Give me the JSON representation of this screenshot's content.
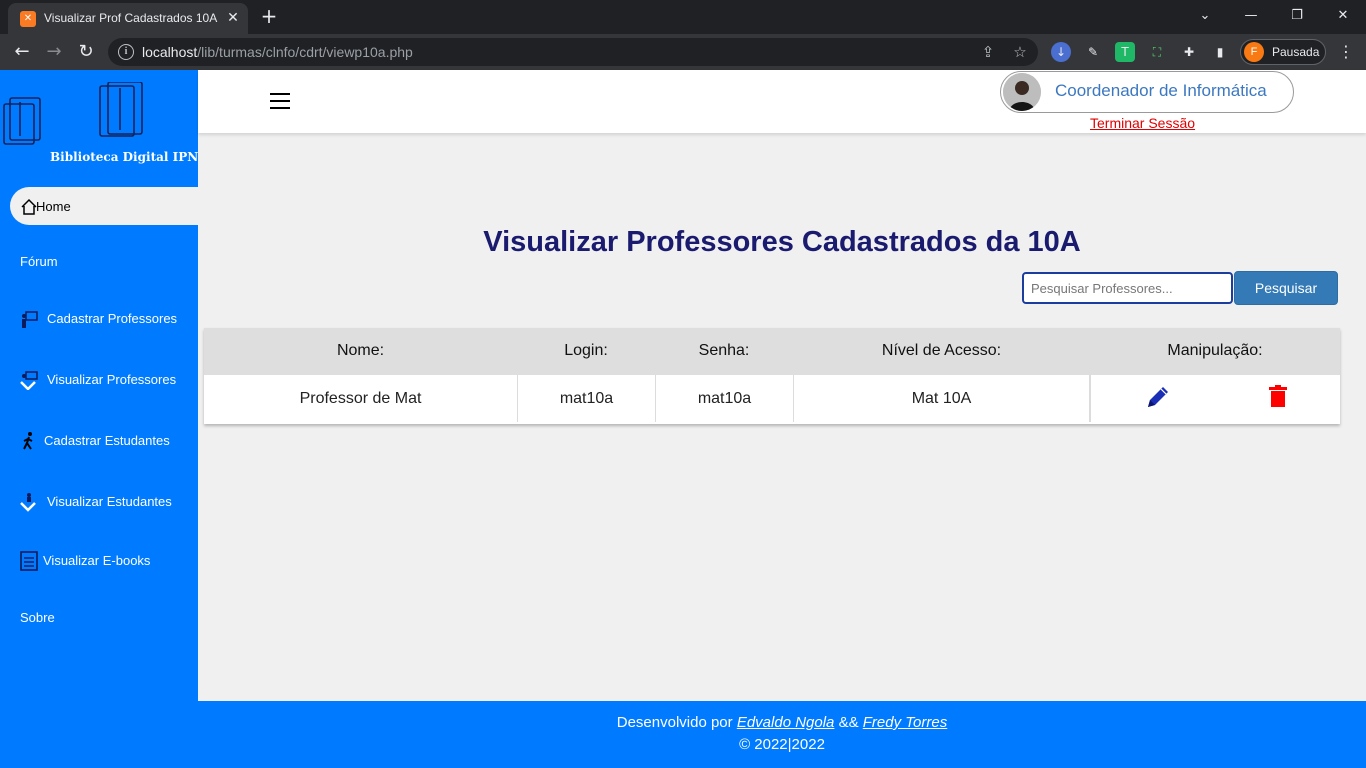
{
  "browser": {
    "tab_title": "Visualizar Prof Cadastrados 10A",
    "url_host": "localhost",
    "url_path": "/lib/turmas/clnfo/cdrt/viewp10a.php",
    "profile_initial": "F",
    "profile_label": "Pausada"
  },
  "sidebar": {
    "logo_text": "Biblioteca Digital IPN",
    "items": [
      {
        "label": "Home",
        "icon": "home-icon"
      },
      {
        "label": "Fórum"
      },
      {
        "label": "Cadastrar Professores",
        "icon": "teacher-board-icon"
      },
      {
        "label": "Visualizar Professores",
        "icon": "teacher-view-icon"
      },
      {
        "label": "Cadastrar Estudantes",
        "icon": "walking-person-icon"
      },
      {
        "label": "Visualizar Estudantes",
        "icon": "student-view-icon"
      },
      {
        "label": "Visualizar E-books",
        "icon": "ebook-icon"
      },
      {
        "label": "Sobre"
      }
    ]
  },
  "header": {
    "user_name": "Coordenador de Informática",
    "logout": "Terminar Sessão"
  },
  "main": {
    "title": "Visualizar Professores Cadastrados da 10A",
    "search_placeholder": "Pesquisar Professores...",
    "search_button": "Pesquisar",
    "columns": [
      "Nome:",
      "Login:",
      "Senha:",
      "Nível de Acesso:",
      "Manipulação:"
    ],
    "rows": [
      {
        "nome": "Professor de Mat",
        "login": "mat10a",
        "senha": "mat10a",
        "nivel": "Mat 10A"
      }
    ]
  },
  "footer": {
    "prefix": "Desenvolvido por ",
    "author1": "Edvaldo Ngola",
    "separator": " && ",
    "author2": "Fredy Torres",
    "copyright": "© 2022|2022"
  },
  "colors": {
    "sidebar": "#007bff",
    "title": "#1a1a6e",
    "logout": "#e00000",
    "delete": "#ff0000",
    "edit": "#1a2fb5"
  }
}
